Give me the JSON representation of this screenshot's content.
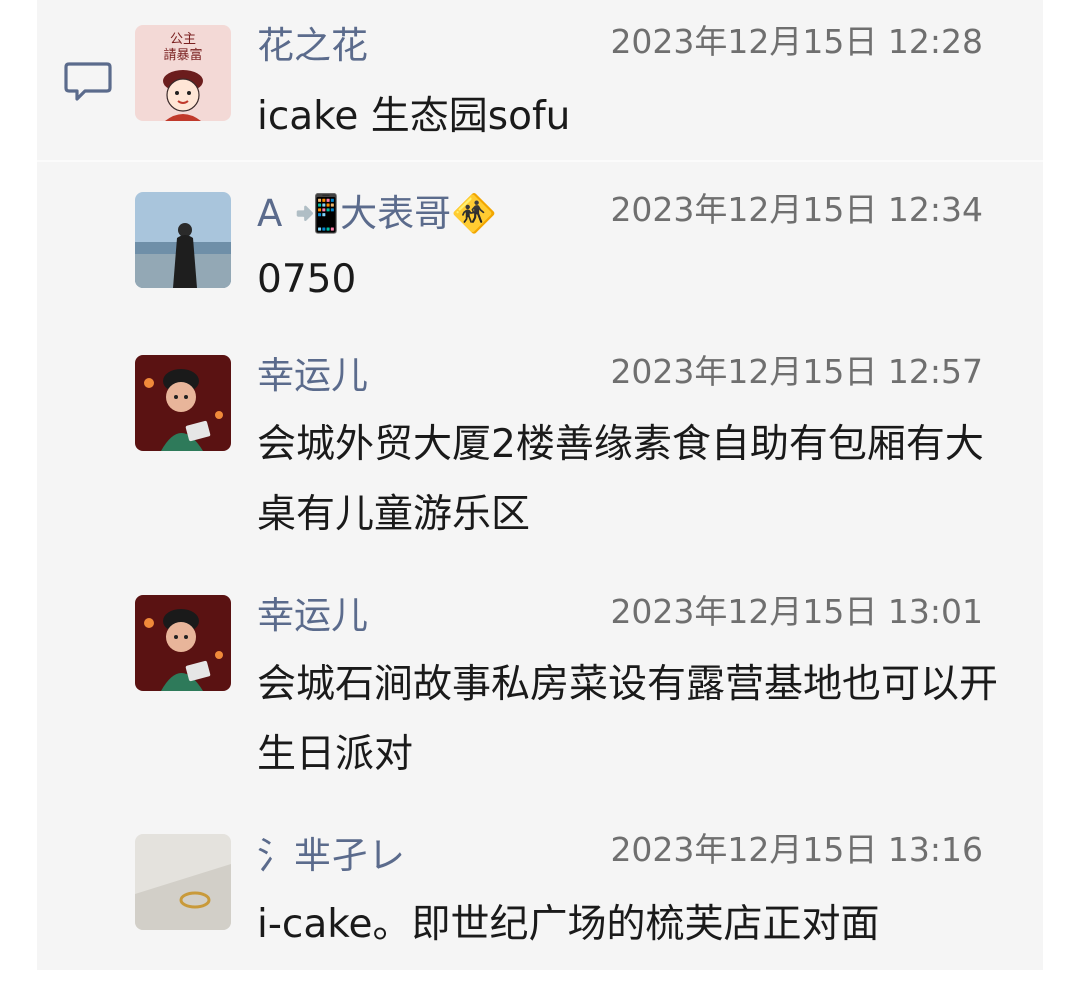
{
  "comments": [
    {
      "nickname": "花之花",
      "time": "2023年12月15日 12:28",
      "text": " icake 生态园sofu",
      "avatar_text_line1": "公主",
      "avatar_text_line2": "請暴富"
    },
    {
      "nickname": "A 📲大表哥🚸",
      "time": "2023年12月15日 12:34",
      "text": "0750"
    },
    {
      "nickname": "幸运儿",
      "time": "2023年12月15日 12:57",
      "text": "会城外贸大厦2楼善缘素食自助有包厢有大桌有儿童游乐区"
    },
    {
      "nickname": "幸运儿",
      "time": "2023年12月15日 13:01",
      "text": "会城石涧故事私房菜设有露营基地也可以开生日派对"
    },
    {
      "nickname": "氵芈孑レ",
      "time": "2023年12月15日 13:16",
      "text": "i-cake。即世纪广场的梳芙店正对面"
    }
  ],
  "colors": {
    "background": "#f5f5f5",
    "nickname": "#5b6b8c",
    "time": "#6f6f6f",
    "text": "#1a1a1a"
  },
  "icons": {
    "comment": "comment-icon"
  }
}
